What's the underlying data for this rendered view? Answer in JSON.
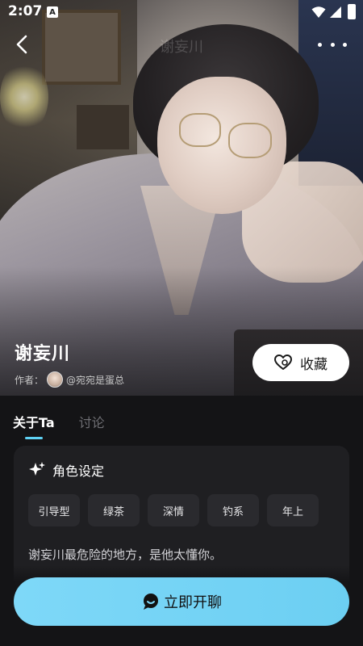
{
  "status_bar": {
    "time": "2:07",
    "a_label": "A"
  },
  "nav": {
    "title": "谢妄川",
    "back_icon": "chevron-left-icon",
    "more_icon": "more-dots-icon"
  },
  "character": {
    "name": "谢妄川",
    "author_label": "作者：",
    "author_name": "@宛宛是蛋总"
  },
  "favorite_button": {
    "label": "收藏",
    "icon": "heart-icon"
  },
  "tabs": [
    {
      "label": "关于Ta",
      "active": true
    },
    {
      "label": "讨论",
      "active": false
    }
  ],
  "role_card": {
    "title": "角色设定",
    "icon": "sparkle-icon",
    "tags": [
      "引导型",
      "绿茶",
      "深情",
      "钓系",
      "年上"
    ],
    "description": "谢妄川最危险的地方，是他太懂你。"
  },
  "cta": {
    "label": "立即开聊",
    "icon": "chat-bubble-icon"
  },
  "colors": {
    "accent": "#5fd2f4",
    "cta_bg": "#7ed8f8",
    "panel_bg": "#141416",
    "card_bg": "#1f1f22"
  }
}
